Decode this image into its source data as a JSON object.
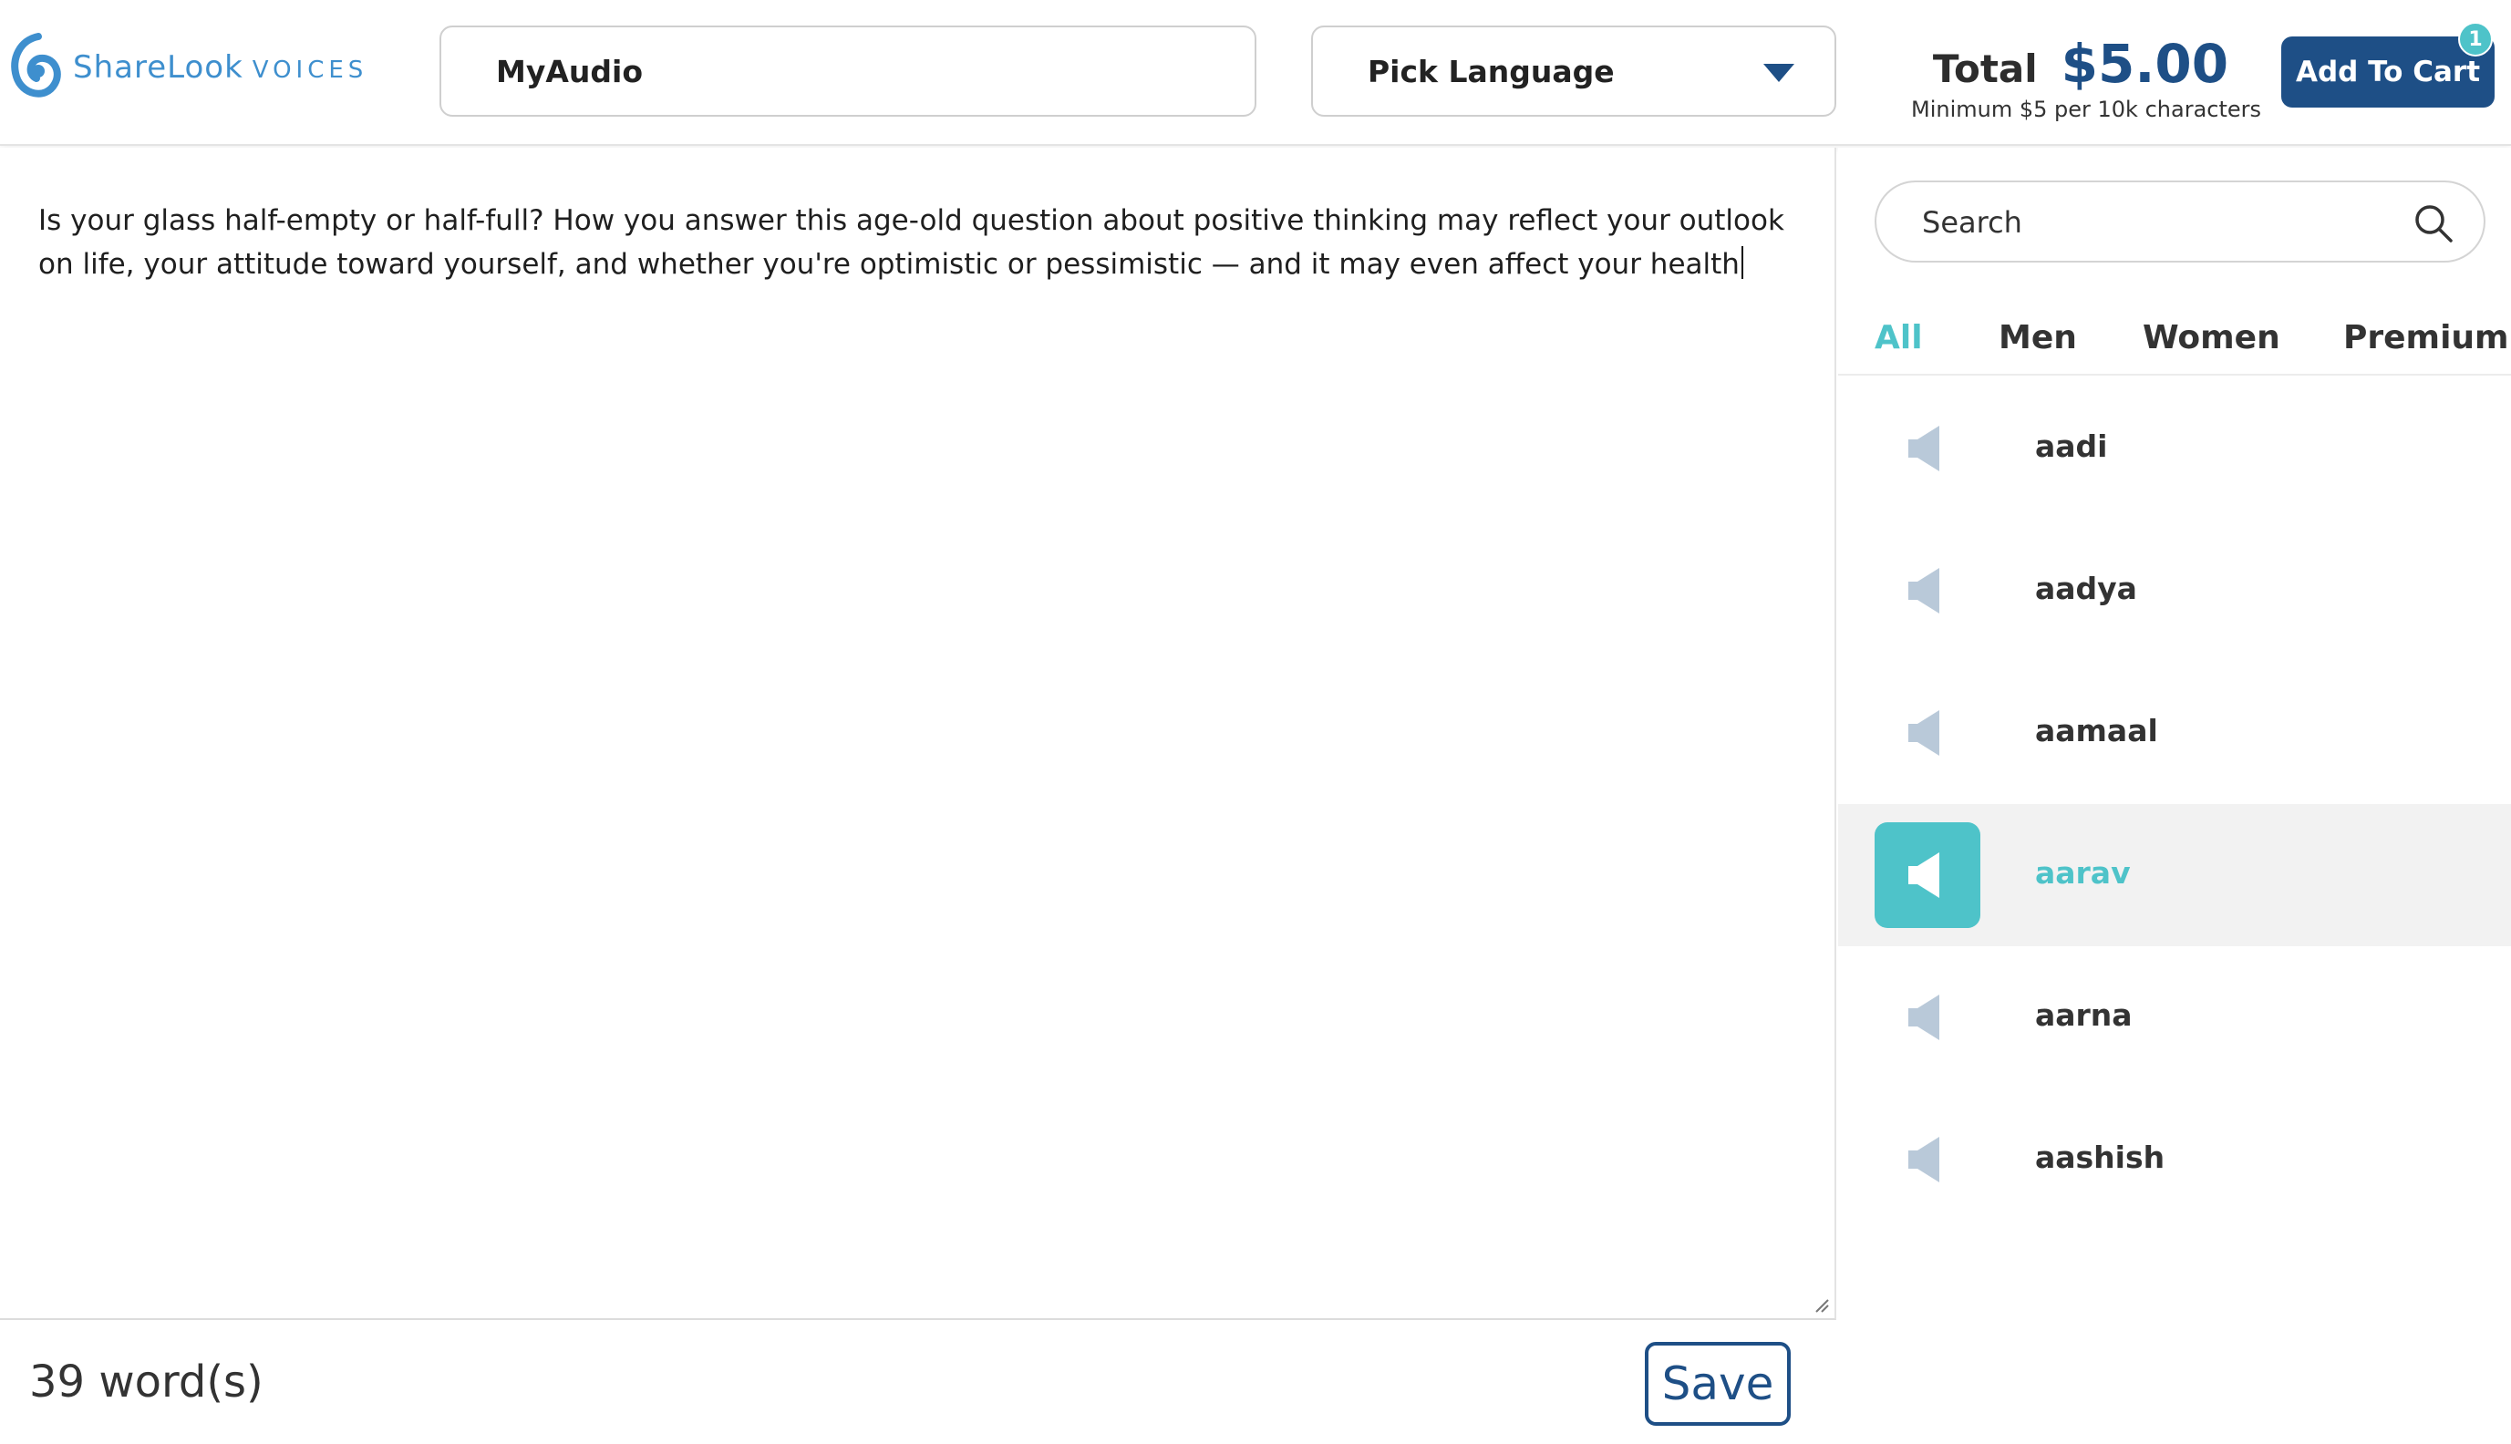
{
  "header": {
    "brand": {
      "name": "ShareLook",
      "suffix": "VOICES"
    },
    "project_name": {
      "value": "MyAudio",
      "placeholder": ""
    },
    "language": {
      "selected": "Pick Language"
    },
    "total": {
      "label": "Total",
      "amount": "$5.00",
      "note": "Minimum $5 per 10k characters"
    },
    "cart": {
      "label": "Add To Cart",
      "badge": "1"
    }
  },
  "editor": {
    "text": "Is your glass half-empty or half-full? How you answer this age-old question about positive thinking may reflect your outlook on life, your attitude toward yourself, and whether you're optimistic or pessimistic — and it may even affect your health",
    "word_count": "39 word(s)",
    "save_label": "Save"
  },
  "sidebar": {
    "search": {
      "placeholder": "Search"
    },
    "tabs": [
      {
        "label": "All",
        "active": true
      },
      {
        "label": "Men",
        "active": false
      },
      {
        "label": "Women",
        "active": false
      },
      {
        "label": "Premium",
        "active": false
      }
    ],
    "voices": [
      {
        "name": "aadi",
        "selected": false
      },
      {
        "name": "aadya",
        "selected": false
      },
      {
        "name": "aamaal",
        "selected": false
      },
      {
        "name": "aarav",
        "selected": true
      },
      {
        "name": "aarna",
        "selected": false
      },
      {
        "name": "aashish",
        "selected": false
      }
    ]
  },
  "colors": {
    "brand_blue": "#1e4f86",
    "accent_teal": "#4ec3c9",
    "logo_blue": "#3e8fce",
    "speaker_inactive": "#b9c9d9"
  },
  "icons": {
    "logo": "sharelook-swirl-icon",
    "language_caret": "caret-down-icon",
    "search": "search-icon",
    "voice": "speaker-icon"
  }
}
